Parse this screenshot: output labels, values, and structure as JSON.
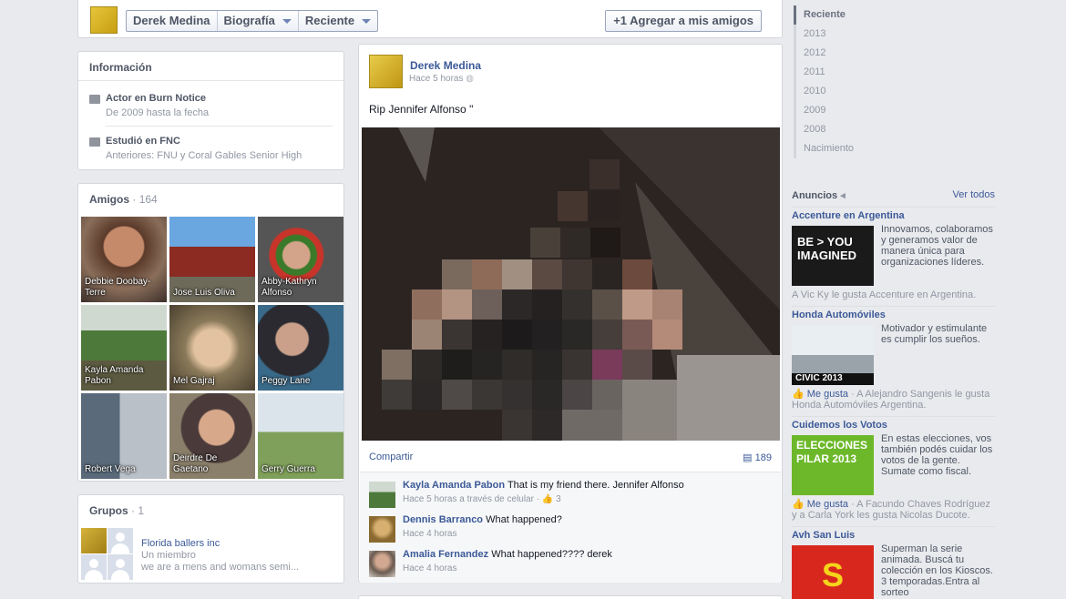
{
  "header": {
    "name": "Derek Medina",
    "biography": "Biografía",
    "recent": "Reciente",
    "add_friend": "+1 Agregar a mis amigos"
  },
  "info": {
    "title": "Información",
    "work_line": "Actor en Burn Notice",
    "work_dates": "De 2009 hasta la fecha",
    "edu_line": "Estudió en FNC",
    "edu_prev": "Anteriores: FNU y Coral Gables Senior High"
  },
  "friends": {
    "title": "Amigos",
    "count": "· 164",
    "list": [
      {
        "name": "Debbie Doobay-Terre"
      },
      {
        "name": "Jose Luis Oliva"
      },
      {
        "name": "Abby-Kathryn Alfonso"
      },
      {
        "name": "Kayla Amanda Pabon"
      },
      {
        "name": "Mel Gajraj"
      },
      {
        "name": "Peggy Lane"
      },
      {
        "name": "Robert Vega"
      },
      {
        "name": "Deirdre De Gaetano"
      },
      {
        "name": "Gerry Guerra"
      }
    ]
  },
  "groups": {
    "title": "Grupos",
    "count": "· 1",
    "name": "Florida ballers inc",
    "members": "Un miembro",
    "desc": "we are a mens and womans semi..."
  },
  "post": {
    "author": "Derek Medina",
    "time": "Hace 5 horas",
    "text": "Rip Jennifer Alfonso \"",
    "share": "Compartir",
    "comment_count": "189",
    "comments": [
      {
        "author": "Kayla Amanda Pabon",
        "text": "That is my friend there. Jennifer Alfonso",
        "meta": "Hace 5 horas a través de celular · 👍 3"
      },
      {
        "author": "Dennis Barranco",
        "text": "What happened?",
        "meta": "Hace 4 horas"
      },
      {
        "author": "Amalia Fernandez",
        "text": "What happened???? derek",
        "meta": "Hace 4 horas"
      }
    ]
  },
  "timeline": [
    "Reciente",
    "2013",
    "2012",
    "2011",
    "2010",
    "2009",
    "2008",
    "Nacimiento"
  ],
  "ads": {
    "title": "Anuncios",
    "see_all": "Ver todos",
    "items": [
      {
        "title": "Accenture en Argentina",
        "desc": "Innovamos, colaboramos y generamos valor de manera única para organizaciones líderes.",
        "foot": "A Vic Ky le gusta Accenture en Argentina.",
        "img_text": "BE > YOU IMAGINED"
      },
      {
        "title": "Honda Automóviles",
        "desc": "Motivador y estimulante es cumplir los sueños.",
        "like": "Me gusta",
        "foot": " · A Alejandro Sangenis le gusta Honda Automóviles Argentina.",
        "img_text": "CIVIC 2013"
      },
      {
        "title": "Cuidemos los Votos",
        "desc": "En estas elecciones, vos también podés cuidar los votos de la gente. Sumate como fiscal.",
        "like": "Me gusta",
        "foot": " · A Facundo Chaves Rodríguez y a Carla York les gusta Nicolas Ducote.",
        "img_text": "ELECCIONES PILAR 2013"
      },
      {
        "title": "Avh San Luis",
        "desc": "Superman la serie animada. Buscá tu colección en los Kioscos. 3 temporadas.Entra al sorteo",
        "img_text": "S"
      }
    ]
  },
  "colors": {
    "link": "#3b5998",
    "background": "#e9eaed",
    "card_border": "#d3d6db"
  }
}
